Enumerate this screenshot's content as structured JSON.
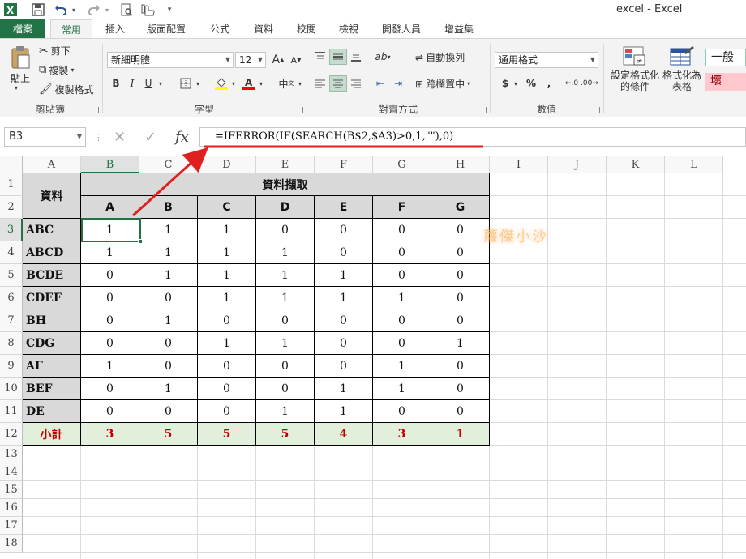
{
  "app_title": "excel - Excel",
  "tabs": [
    "檔案",
    "常用",
    "插入",
    "版面配置",
    "公式",
    "資料",
    "校閱",
    "檢視",
    "開發人員",
    "增益集"
  ],
  "active_tab": "常用",
  "ribbon": {
    "clipboard": {
      "paste": "貼上",
      "cut": "剪下",
      "copy": "複製",
      "format_painter": "複製格式",
      "label": "剪貼簿"
    },
    "font": {
      "name": "新細明體",
      "size": "12",
      "grow": "A",
      "shrink": "A",
      "bold": "B",
      "italic": "I",
      "underline": "U",
      "phonetic": "中",
      "label": "字型"
    },
    "alignment": {
      "wrap": "自動換列",
      "merge": "跨欄置中",
      "label": "對齊方式"
    },
    "number": {
      "format": "通用格式",
      "currency": "$",
      "percent": "%",
      "comma": ",",
      "label": "數值"
    },
    "styles": {
      "conditional": "設定格式化\n的條件",
      "table": "格式化為\n表格",
      "normal": "一般",
      "bad": "壞"
    }
  },
  "formula_bar": {
    "name_box": "B3",
    "fx": "fx",
    "formula": "=IFERROR(IF(SEARCH(B$2,$A3)>0,1,\"\"),0)"
  },
  "grid": {
    "columns": [
      "A",
      "B",
      "C",
      "D",
      "E",
      "F",
      "G",
      "H",
      "I",
      "J",
      "K",
      "L"
    ],
    "rows": [
      "1",
      "2",
      "3",
      "4",
      "5",
      "6",
      "7",
      "8",
      "9",
      "10",
      "11",
      "12",
      "13",
      "14",
      "15",
      "16",
      "17",
      "18"
    ],
    "selected_cell": "B3"
  },
  "table": {
    "data_header": "資料",
    "extract_header": "資料擷取",
    "letters": [
      "A",
      "B",
      "C",
      "D",
      "E",
      "F",
      "G"
    ],
    "rows": [
      {
        "label": "ABC",
        "values": [
          "1",
          "1",
          "1",
          "0",
          "0",
          "0",
          "0"
        ]
      },
      {
        "label": "ABCD",
        "values": [
          "1",
          "1",
          "1",
          "1",
          "0",
          "0",
          "0"
        ]
      },
      {
        "label": "BCDE",
        "values": [
          "0",
          "1",
          "1",
          "1",
          "1",
          "0",
          "0"
        ]
      },
      {
        "label": "CDEF",
        "values": [
          "0",
          "0",
          "1",
          "1",
          "1",
          "1",
          "0"
        ]
      },
      {
        "label": "BH",
        "values": [
          "0",
          "1",
          "0",
          "0",
          "0",
          "0",
          "0"
        ]
      },
      {
        "label": "CDG",
        "values": [
          "0",
          "0",
          "1",
          "1",
          "0",
          "0",
          "1"
        ]
      },
      {
        "label": "AF",
        "values": [
          "1",
          "0",
          "0",
          "0",
          "0",
          "1",
          "0"
        ]
      },
      {
        "label": "BEF",
        "values": [
          "0",
          "1",
          "0",
          "0",
          "1",
          "1",
          "0"
        ]
      },
      {
        "label": "DE",
        "values": [
          "0",
          "0",
          "0",
          "1",
          "1",
          "0",
          "0"
        ]
      }
    ],
    "subtotal_label": "小計",
    "subtotals": [
      "3",
      "5",
      "5",
      "5",
      "4",
      "3",
      "1"
    ]
  },
  "watermark": "蘿傑小沙",
  "colors": {
    "excel_green": "#217346",
    "annotation_red": "#e02020",
    "subtotal_red": "#c00000",
    "header_gray": "#d9d9d9",
    "subtotal_bg": "#e2efda"
  }
}
